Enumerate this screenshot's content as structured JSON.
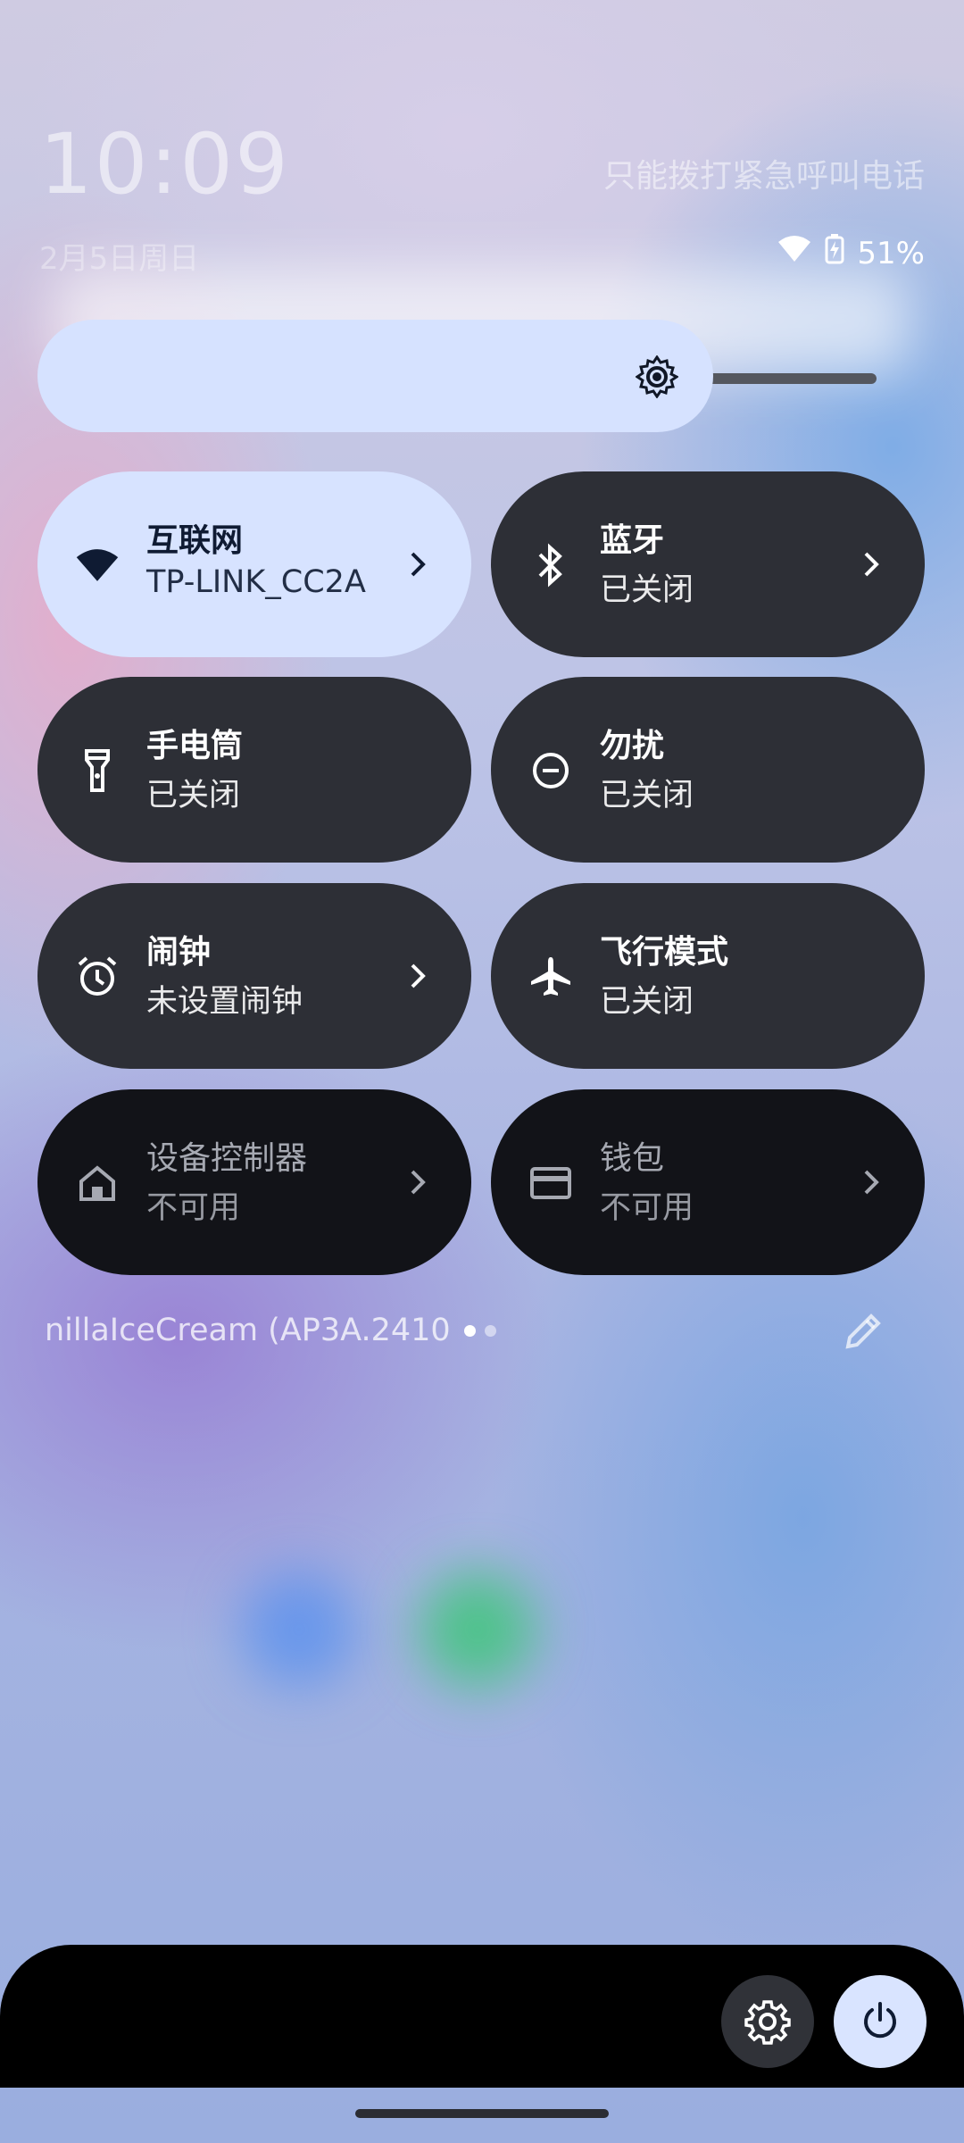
{
  "lockscreen": {
    "time": "10:09",
    "date": "2月5日周日",
    "carrier": "只能拨打紧急呼叫电话"
  },
  "status_bar": {
    "battery": "51%",
    "wifi_icon": "wifi-icon",
    "battery_icon": "battery-charging-icon"
  },
  "brightness": {
    "level": 0.78,
    "icon": "brightness-icon"
  },
  "tiles": [
    {
      "title": "互联网",
      "subtitle": "TP-LINK_CC2A",
      "icon": "wifi-icon",
      "state": "active",
      "chevron": true
    },
    {
      "title": "蓝牙",
      "subtitle": "已关闭",
      "icon": "bluetooth-icon",
      "state": "off",
      "chevron": true
    },
    {
      "title": "手电筒",
      "subtitle": "已关闭",
      "icon": "flashlight-icon",
      "state": "off",
      "chevron": false
    },
    {
      "title": "勿扰",
      "subtitle": "已关闭",
      "icon": "do-not-disturb-icon",
      "state": "off",
      "chevron": false
    },
    {
      "title": "闹钟",
      "subtitle": "未设置闹钟",
      "icon": "alarm-icon",
      "state": "off",
      "chevron": true
    },
    {
      "title": "飞行模式",
      "subtitle": "已关闭",
      "icon": "airplane-icon",
      "state": "off",
      "chevron": false
    },
    {
      "title": "设备控制器",
      "subtitle": "不可用",
      "icon": "home-icon",
      "state": "unavailable",
      "chevron": true
    },
    {
      "title": "钱包",
      "subtitle": "不可用",
      "icon": "wallet-icon",
      "state": "unavailable",
      "chevron": true
    }
  ],
  "footer": {
    "build": "nillaIceCream (AP3A.2410",
    "page_count": 2,
    "current_page": 1
  },
  "colors": {
    "active_tile": "#d7e3ff",
    "off_tile": "#2d2f36",
    "unavailable_tile": "#121318"
  }
}
